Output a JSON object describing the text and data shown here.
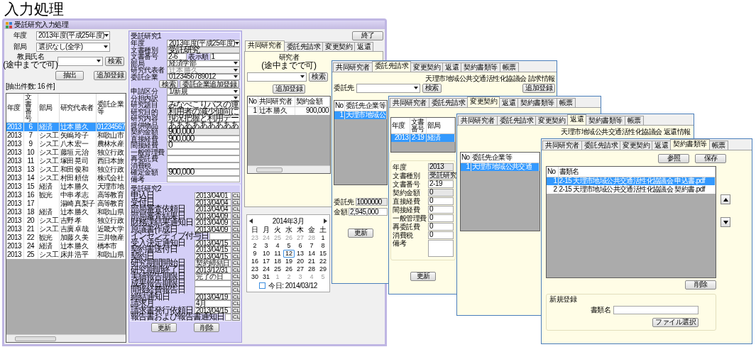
{
  "page_title": "入力処理",
  "main_window": {
    "title": "受託研究入力処理",
    "year_label": "年度",
    "year_value": "2013年度(平成25年度)",
    "dept_label": "部局",
    "dept_value": "選択なし(全学)",
    "name_label": "教員氏名",
    "name_hint": "(途中までで可)",
    "name_search_button": "検索",
    "extract_button": "抽出",
    "add_button": "追加登録",
    "result_count": "[抽出件数: 16 件]",
    "list": {
      "columns": [
        "年度",
        "文書番号",
        "部局",
        "研究代表者",
        "委託企業等"
      ],
      "rows": [
        {
          "cells": [
            "2013",
            "6",
            "経済",
            "辻本 勝久",
            "01234567"
          ],
          "selected": true
        },
        {
          "cells": [
            "2013",
            "7",
            "シス工",
            "矢嶋 玲子",
            "和歌山市"
          ],
          "selected": false
        },
        {
          "cells": [
            "2013",
            "9",
            "シス工",
            "八木 宏一",
            "農林水産"
          ],
          "selected": false
        },
        {
          "cells": [
            "2013",
            "10",
            "シス工",
            "藤垣 元治",
            "独立行政"
          ],
          "selected": false
        },
        {
          "cells": [
            "2013",
            "11",
            "シス工",
            "塚田 晃司",
            "西日本旅"
          ],
          "selected": false
        },
        {
          "cells": [
            "2013",
            "13",
            "シス工",
            "和田 俊和",
            "独立行政"
          ],
          "selected": false
        },
        {
          "cells": [
            "2013",
            "14",
            "シス工",
            "村田 頼信",
            "株式会社"
          ],
          "selected": false
        },
        {
          "cells": [
            "2013",
            "15",
            "経済",
            "辻本 勝久",
            "天理市地"
          ],
          "selected": false
        },
        {
          "cells": [
            "2013",
            "16",
            "観光",
            "中串 孝志",
            "高等教育"
          ],
          "selected": false
        },
        {
          "cells": [
            "2013",
            "17",
            null,
            "湯崎 真梨子",
            "高等教育"
          ],
          "selected": false
        },
        {
          "cells": [
            "2013",
            "18",
            "経済",
            "辻本 勝久",
            "和歌山県"
          ],
          "selected": false
        },
        {
          "cells": [
            "2013",
            "20",
            "シス工",
            "吉野 孝",
            "独立行政"
          ],
          "selected": false
        },
        {
          "cells": [
            "2013",
            "21",
            "シス工",
            "吉廣 卓哉",
            "近畿大学"
          ],
          "selected": false
        },
        {
          "cells": [
            "2013",
            "22",
            "観光",
            "加藤 久美",
            "三井物産"
          ],
          "selected": false
        },
        {
          "cells": [
            "2013",
            "24",
            "経済",
            "辻本 勝久",
            "橋本市"
          ],
          "selected": false
        },
        {
          "cells": [
            "2013",
            "25",
            "シス工",
            "床井 浩平",
            "和歌山県"
          ],
          "selected": false
        }
      ]
    },
    "group1": {
      "title": "受託研究1",
      "rows": [
        {
          "kind": "combo",
          "label": "年度",
          "value": "2013年度(平成25年度)",
          "disabled": false
        },
        {
          "kind": "readonly",
          "label": "文書種別",
          "value": "受託研究"
        },
        {
          "kind": "pair",
          "label": "文書番号",
          "value": "2-6",
          "label2": "表示順",
          "value2": "1"
        },
        {
          "kind": "combo",
          "label": "部局",
          "value": "経済学部",
          "disabled": false
        },
        {
          "kind": "combo",
          "label": "研究代表者",
          "value": "辻本 勝久",
          "disabled": true
        },
        {
          "kind": "combo",
          "label": "委託企業",
          "value": "0123456789012",
          "disabled": false
        },
        {
          "kind": "buttons",
          "buttons": [
            "検索",
            "委託企業追加登録"
          ]
        },
        {
          "kind": "combo",
          "label": "申請区分",
          "value": "1/新規",
          "disabled": false
        },
        {
          "kind": "combo",
          "label": "分担内訳",
          "disabled": false
        },
        {
          "kind": "text",
          "label": "研究題目",
          "value": "みなべこりバスの運"
        },
        {
          "kind": "text",
          "label": "研究目的",
          "value": "利用者の減少傾向に"
        },
        {
          "kind": "text",
          "label": "研究内容",
          "value": "現況把握と利用デー"
        },
        {
          "kind": "text",
          "label": "提供物品",
          "value": "あああああああああ"
        },
        {
          "kind": "readonly",
          "label": "契約金額",
          "value": "900,000"
        },
        {
          "kind": "text",
          "label": "直接経費",
          "value": "900,000"
        },
        {
          "kind": "text",
          "label": "間接経費",
          "value": "0"
        },
        {
          "kind": "text",
          "label": "一般管理費"
        },
        {
          "kind": "text",
          "label": "再委託費"
        },
        {
          "kind": "text",
          "label": "消費税"
        },
        {
          "kind": "text",
          "label": "確定金額",
          "value": "900,000"
        },
        {
          "kind": "text",
          "label": "備考"
        }
      ]
    },
    "group2": {
      "title": "受託研究2",
      "rows": [
        {
          "label": "申込日",
          "value": "2013/04/01",
          "button": "CL"
        },
        {
          "label": "受付日",
          "value": "2013/04/04",
          "button": "CL"
        },
        {
          "label": "部局審査依頼日",
          "value": "2013/04/04",
          "button": "CL"
        },
        {
          "label": "部局審査結果日",
          "value": "2013/04/09",
          "button": "CL"
        },
        {
          "label": "財務課結果通知日",
          "value": "2013/04/09",
          "button": "CL"
        },
        {
          "label": "原議書作成日",
          "value": "2013/04/09",
          "button": "CL"
        },
        {
          "label": "インセンティブ付与日",
          "button": "CL"
        },
        {
          "label": "受入決定通知日",
          "value": "2013/04/15",
          "button": "CL"
        },
        {
          "label": "契約書送付日",
          "value": "2013/04/15",
          "button": "CL"
        },
        {
          "label": "契約日",
          "value": "2013/04/15",
          "button": "CL"
        },
        {
          "label": "研究期間開始日",
          "value": "契約締結日",
          "button": "CL"
        },
        {
          "label": "研究期間終了日",
          "value": "2013/12/31",
          "button": "CL"
        },
        {
          "label": "実績報告期限日",
          "value": "完了の日",
          "button": "CL"
        },
        {
          "label": "成果報告期限日",
          "button": "CL"
        },
        {
          "label": "間接経費報告日",
          "button": "CL"
        },
        {
          "label": "締結通知日",
          "value": "2013/04/19",
          "button": "CL"
        },
        {
          "label": "請求月",
          "value": "4月",
          "button": "CL"
        },
        {
          "label": "請求書発行依頼日",
          "value": "2013/04/15",
          "button": "CL"
        },
        {
          "label": "報告書および報告書通知日",
          "button": "CL"
        }
      ]
    },
    "update_button": "更新",
    "delete_button": "削除",
    "end_button": "終了",
    "tabs": [
      {
        "label": "共同研究者",
        "selected": true
      },
      {
        "label": "委託先請求",
        "selected": false
      },
      {
        "label": "変更契約",
        "selected": false
      },
      {
        "label": "返還",
        "selected": false
      }
    ],
    "researcher_label": "研究者",
    "researcher_hint": "(途中までで可)",
    "researcher_search_button": "検索",
    "researcher_add_button": "追加登録",
    "co_table": {
      "columns": [
        "No",
        "共同研究者",
        "契約金額"
      ],
      "rows": [
        {
          "cells": [
            "1",
            "辻本 勝久",
            "900,000"
          ],
          "selected": false
        }
      ]
    },
    "calendar": {
      "month": "2014年3月",
      "weekdays": [
        "日",
        "月",
        "火",
        "水",
        "木",
        "金",
        "土"
      ],
      "today": "今日: 2014/03/12",
      "weeks": [
        [
          {
            "day": "23",
            "other": true,
            "selected": false
          },
          {
            "day": "24",
            "other": true,
            "selected": false
          },
          {
            "day": "25",
            "other": true,
            "selected": false
          },
          {
            "day": "26",
            "other": true,
            "selected": false
          },
          {
            "day": "27",
            "other": true,
            "selected": false
          },
          {
            "day": "28",
            "other": true,
            "selected": false
          },
          {
            "day": "1",
            "other": false,
            "selected": false
          }
        ],
        [
          {
            "day": "2",
            "other": false,
            "selected": false
          },
          {
            "day": "3",
            "other": false,
            "selected": false
          },
          {
            "day": "4",
            "other": false,
            "selected": false
          },
          {
            "day": "5",
            "other": false,
            "selected": false
          },
          {
            "day": "6",
            "other": false,
            "selected": false
          },
          {
            "day": "7",
            "other": false,
            "selected": false
          },
          {
            "day": "8",
            "other": false,
            "selected": false
          }
        ],
        [
          {
            "day": "9",
            "other": false,
            "selected": false
          },
          {
            "day": "10",
            "other": false,
            "selected": false
          },
          {
            "day": "11",
            "other": false,
            "selected": false
          },
          {
            "day": "12",
            "other": false,
            "selected": true
          },
          {
            "day": "13",
            "other": false,
            "selected": false
          },
          {
            "day": "14",
            "other": false,
            "selected": false
          },
          {
            "day": "15",
            "other": false,
            "selected": false
          }
        ],
        [
          {
            "day": "16",
            "other": false,
            "selected": false
          },
          {
            "day": "17",
            "other": false,
            "selected": false
          },
          {
            "day": "18",
            "other": false,
            "selected": false
          },
          {
            "day": "19",
            "other": false,
            "selected": false
          },
          {
            "day": "20",
            "other": false,
            "selected": false
          },
          {
            "day": "21",
            "other": false,
            "selected": false
          },
          {
            "day": "22",
            "other": false,
            "selected": false
          }
        ],
        [
          {
            "day": "23",
            "other": false,
            "selected": false
          },
          {
            "day": "24",
            "other": false,
            "selected": false
          },
          {
            "day": "25",
            "other": false,
            "selected": false
          },
          {
            "day": "26",
            "other": false,
            "selected": false
          },
          {
            "day": "27",
            "other": false,
            "selected": false
          },
          {
            "day": "28",
            "other": false,
            "selected": false
          },
          {
            "day": "29",
            "other": false,
            "selected": false
          }
        ],
        [
          {
            "day": "30",
            "other": false,
            "selected": false
          },
          {
            "day": "31",
            "other": false,
            "selected": false
          },
          {
            "day": "1",
            "other": true,
            "selected": false
          },
          {
            "day": "2",
            "other": true,
            "selected": false
          },
          {
            "day": "3",
            "other": true,
            "selected": false
          },
          {
            "day": "4",
            "other": true,
            "selected": false
          },
          {
            "day": "5",
            "other": true,
            "selected": false
          }
        ]
      ]
    }
  },
  "billing_panel": {
    "tabs": [
      {
        "label": "共同研究者",
        "selected": false
      },
      {
        "label": "委託先請求",
        "selected": true
      },
      {
        "label": "変更契約",
        "selected": false
      },
      {
        "label": "返還",
        "selected": false
      },
      {
        "label": "契約書類等",
        "selected": false
      },
      {
        "label": "帳票",
        "selected": false
      }
    ],
    "header": "天理市地域公共交通活性化協議会 請求情報",
    "client_label": "委託先",
    "search_button": "検索",
    "add_button": "追加登録",
    "table": {
      "columns": [
        "No",
        "委託先企業等"
      ],
      "rows": [
        {
          "cells": [
            "1",
            "天理市地域公"
          ],
          "selected": true
        }
      ]
    },
    "fields": [
      {
        "label": "委託先",
        "value": "1000000",
        "readonly": true
      },
      {
        "label": "金額",
        "value": "2,945,000",
        "readonly": false
      }
    ],
    "update_button": "更新"
  },
  "change_panel": {
    "tabs": [
      {
        "label": "共同研究者",
        "selected": false
      },
      {
        "label": "委託先請求",
        "selected": false
      },
      {
        "label": "変更契約",
        "selected": true
      },
      {
        "label": "返還",
        "selected": false
      },
      {
        "label": "契約書類等",
        "selected": false
      },
      {
        "label": "帳票",
        "selected": false
      }
    ],
    "table": {
      "columns": [
        "年度",
        "文書番号",
        "部局"
      ],
      "rows": [
        {
          "cells": [
            "2013",
            "2-19",
            "経済"
          ],
          "selected": true
        }
      ]
    },
    "fields": [
      {
        "kind": "field",
        "label": "年度",
        "value": "2013",
        "readonly": true
      },
      {
        "kind": "field",
        "label": "文書種別",
        "value": "受託研究",
        "readonly": true
      },
      {
        "kind": "field",
        "label": "文書番号",
        "value": "2-19",
        "readonly": false
      },
      {
        "kind": "field",
        "label": "契約金額",
        "value": "0",
        "readonly": true
      },
      {
        "kind": "field",
        "label": "直接経費",
        "value": "0",
        "readonly": false
      },
      {
        "kind": "field",
        "label": "間接経費",
        "value": "0",
        "readonly": false
      },
      {
        "kind": "field",
        "label": "一般管理費",
        "value": "0",
        "readonly": false
      },
      {
        "kind": "field",
        "label": "再委託費",
        "value": "0",
        "readonly": false
      },
      {
        "kind": "field",
        "label": "消費税",
        "value": "0",
        "readonly": false
      },
      {
        "kind": "memo",
        "label": "備考"
      }
    ],
    "update_button": "更新"
  },
  "refund_panel": {
    "tabs": [
      {
        "label": "共同研究者",
        "selected": false
      },
      {
        "label": "委託先請求",
        "selected": false
      },
      {
        "label": "変更契約",
        "selected": false
      },
      {
        "label": "返還",
        "selected": true
      },
      {
        "label": "契約書類等",
        "selected": false
      },
      {
        "label": "帳票",
        "selected": false
      }
    ],
    "header": "天理市地域公共交通活性化協議会 返還情報",
    "table": {
      "columns": [
        "No",
        "委託先企業等"
      ],
      "rows": [
        {
          "cells": [
            "1",
            "天理市地域公共交通"
          ],
          "selected": true
        }
      ]
    }
  },
  "documents_panel": {
    "tabs": [
      {
        "label": "共同研究者",
        "selected": false
      },
      {
        "label": "委託先請求",
        "selected": false
      },
      {
        "label": "変更契約",
        "selected": false
      },
      {
        "label": "返還",
        "selected": false
      },
      {
        "label": "契約書類等",
        "selected": true
      },
      {
        "label": "帳票",
        "selected": false
      }
    ],
    "browse_button": "参照",
    "save_button": "保存",
    "table": {
      "columns": [
        "No",
        "書類名"
      ],
      "rows": [
        {
          "cells": [
            "1",
            "2-15 天理市地域公共交通活性化協議会 申込書.pdf"
          ],
          "selected": true
        },
        {
          "cells": [
            "2",
            "2-15 天理市地域公共交通活性化協議会 契約書.pdf"
          ],
          "selected": false
        }
      ]
    },
    "delete_button": "削除",
    "new_group_title": "新規登録",
    "doc_name_label": "書類名",
    "file_button": "ファイル選択"
  }
}
